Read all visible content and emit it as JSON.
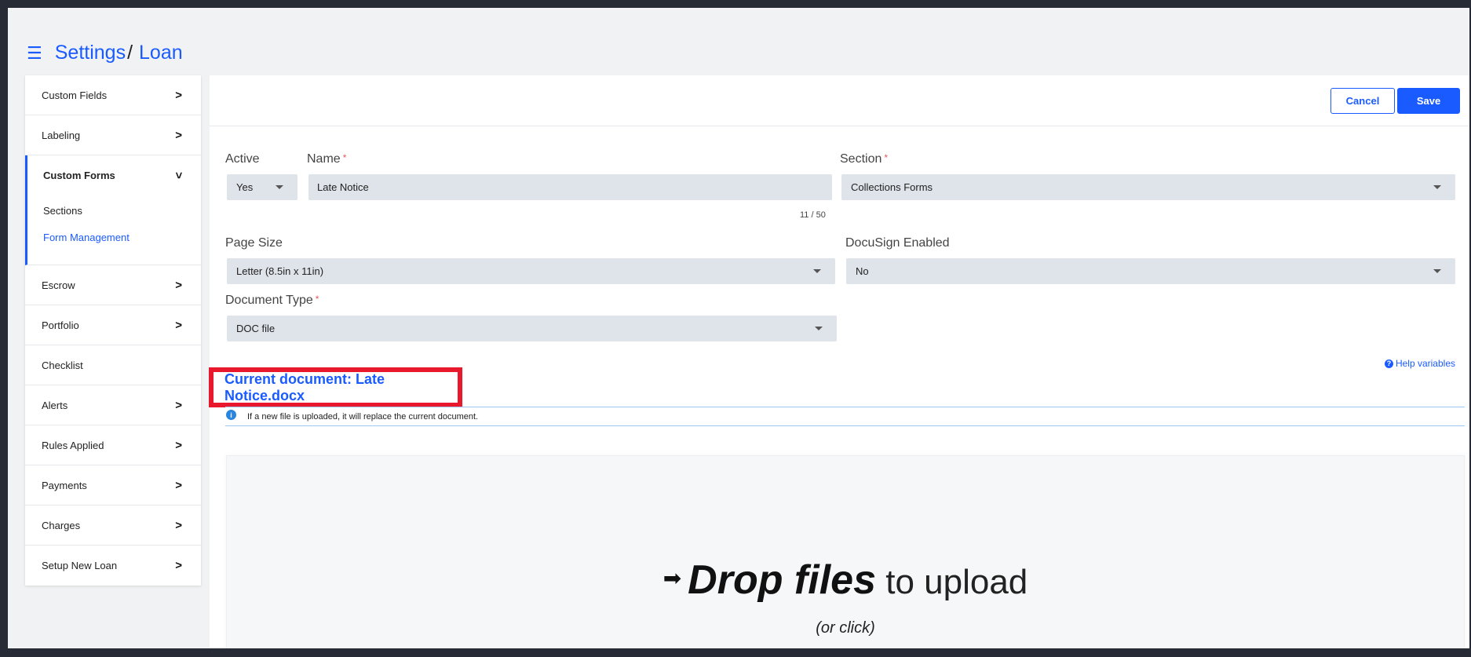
{
  "breadcrumb": {
    "menu_icon": "hamburger-menu-icon",
    "root": "Settings",
    "separator": "/",
    "current": "Loan"
  },
  "sidebar": {
    "items_before": [
      {
        "label": "Custom Fields"
      },
      {
        "label": "Labeling"
      }
    ],
    "group": {
      "label": "Custom Forms",
      "subitems": [
        {
          "label": "Sections"
        },
        {
          "label": "Form Management"
        }
      ]
    },
    "items_after": [
      {
        "label": "Escrow"
      },
      {
        "label": "Portfolio"
      },
      {
        "label": "Checklist"
      },
      {
        "label": "Alerts"
      },
      {
        "label": "Rules Applied"
      },
      {
        "label": "Payments"
      },
      {
        "label": "Charges"
      },
      {
        "label": "Setup New Loan"
      }
    ]
  },
  "toolbar": {
    "cancel_label": "Cancel",
    "save_label": "Save"
  },
  "form": {
    "active": {
      "label": "Active",
      "value": "Yes"
    },
    "name": {
      "label": "Name",
      "required_mark": "*",
      "value": "Late Notice",
      "counter": "11 / 50"
    },
    "section": {
      "label": "Section",
      "required_mark": "*",
      "value": "Collections Forms"
    },
    "page_size": {
      "label": "Page Size",
      "value": "Letter (8.5in x 11in)"
    },
    "docusign": {
      "label": "DocuSign Enabled",
      "value": "No"
    },
    "document_type": {
      "label": "Document Type",
      "required_mark": "*",
      "value": "DOC file"
    }
  },
  "help_variables": "Help variables",
  "current_document": "Current document: Late Notice.docx",
  "notice_text": "If a new file is uploaded, it will replace the current document.",
  "dropzone": {
    "arrow": "➡",
    "title_strong": "Drop files",
    "title_light": " to upload",
    "subtitle": "(or click)"
  },
  "colors": {
    "accent": "#1a5bff",
    "highlight_border": "#e8192c",
    "info": "#2a85e0"
  }
}
